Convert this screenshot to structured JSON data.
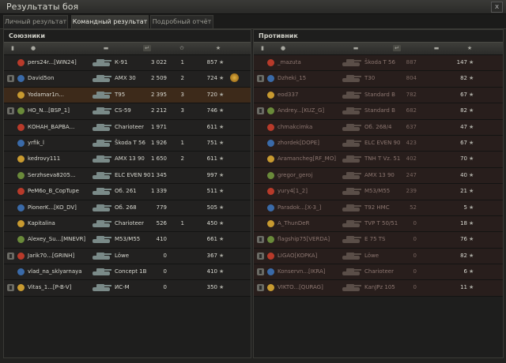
{
  "window": {
    "title": "Результаты боя",
    "close_glyph": "x"
  },
  "tabs": [
    {
      "label": "Личный результат",
      "active": false
    },
    {
      "label": "Командный результат",
      "active": true
    },
    {
      "label": "Подробный отчёт",
      "active": false
    }
  ],
  "allies": {
    "title": "Союзники",
    "rows": [
      {
        "player": "pers24r...[WIN24]",
        "tank": "KV-1",
        "tank_label": "К-91",
        "damage": "3 022",
        "frags": "1",
        "xp": "857",
        "medal": false,
        "me": false
      },
      {
        "player": "David5on",
        "tank": "AMX 30",
        "tank_label": "AMX 30",
        "damage": "2 509",
        "frags": "2",
        "xp": "724",
        "medal": true,
        "me": false
      },
      {
        "player": "Yodamar1n...",
        "tank": "T95",
        "tank_label": "T95",
        "damage": "2 395",
        "frags": "3",
        "xp": "720",
        "medal": false,
        "me": true
      },
      {
        "player": "HO_N...[BSP_1]",
        "tank": "CS-59",
        "tank_label": "CS-59",
        "damage": "2 212",
        "frags": "3",
        "xp": "746",
        "medal": false,
        "me": false
      },
      {
        "player": "КОНАН_ВАРВА...",
        "tank": "Charioteer",
        "tank_label": "Charioteer",
        "damage": "1 971",
        "frags": "",
        "xp": "611",
        "medal": false,
        "me": false
      },
      {
        "player": "yrfik_l",
        "tank": "Skoda T 56",
        "tank_label": "Škoda T 56",
        "damage": "1 926",
        "frags": "1",
        "xp": "751",
        "medal": false,
        "me": false
      },
      {
        "player": "kedrovy111",
        "tank": "AMX 13 90",
        "tank_label": "AMX 13 90",
        "damage": "1 650",
        "frags": "2",
        "xp": "611",
        "medal": false,
        "me": false
      },
      {
        "player": "Serzhseva8205...",
        "tank": "ELC EVEN 90",
        "tank_label": "ELC EVEN 90",
        "damage": "1 345",
        "frags": "",
        "xp": "997",
        "medal": false,
        "me": false
      },
      {
        "player": "PeM6o_B_CopTupe",
        "tank": "Ob. 261",
        "tank_label": "Об. 261",
        "damage": "1 339",
        "frags": "",
        "xp": "511",
        "medal": false,
        "me": false
      },
      {
        "player": "PionerK...[KO_DV]",
        "tank": "Ob. 268",
        "tank_label": "Об. 268",
        "damage": "779",
        "frags": "",
        "xp": "505",
        "medal": false,
        "me": false
      },
      {
        "player": "Kapitalina",
        "tank": "Charioteer",
        "tank_label": "Charioteer",
        "damage": "526",
        "frags": "1",
        "xp": "450",
        "medal": false,
        "me": false
      },
      {
        "player": "Alexey_Su...[MNEVR]",
        "tank": "M53/M55",
        "tank_label": "M53/M55",
        "damage": "410",
        "frags": "",
        "xp": "661",
        "medal": false,
        "me": false
      },
      {
        "player": "Jarik70...[GRINH]",
        "tank": "Lowe",
        "tank_label": "Löwe",
        "damage": "0",
        "frags": "",
        "xp": "367",
        "medal": false,
        "me": false
      },
      {
        "player": "vlad_na_sklyarnaya",
        "tank": "Concept 1B",
        "tank_label": "Concept 1B",
        "damage": "0",
        "frags": "",
        "xp": "410",
        "medal": false,
        "me": false
      },
      {
        "player": "Vitas_1...[P-B-V]",
        "tank": "VC-M",
        "tank_label": "ИС-М",
        "damage": "0",
        "frags": "",
        "xp": "350",
        "medal": false,
        "me": false
      }
    ]
  },
  "enemies": {
    "title": "Противник",
    "rows": [
      {
        "player": "_mazuta",
        "tank": "Skoda T 56",
        "tank_label": "Škoda T 56",
        "damage": "887",
        "frags": "",
        "xp": "147",
        "dead": true
      },
      {
        "player": "Dzheki_15",
        "tank": "T30",
        "tank_label": "T30",
        "damage": "804",
        "frags": "",
        "xp": "82",
        "dead": true
      },
      {
        "player": "eod337",
        "tank": "Standard B",
        "tank_label": "Standard B",
        "damage": "782",
        "frags": "",
        "xp": "67",
        "dead": true
      },
      {
        "player": "Andrey...[KUZ_G]",
        "tank": "Standard B",
        "tank_label": "Standard B",
        "damage": "682",
        "frags": "",
        "xp": "82",
        "dead": true
      },
      {
        "player": "chmakcimka",
        "tank": "Ob. 268/4",
        "tank_label": "Об. 268/4",
        "damage": "637",
        "frags": "",
        "xp": "47",
        "dead": true
      },
      {
        "player": "zhordek[DOPE]",
        "tank": "ELC EVEN 90",
        "tank_label": "ELC EVEN 90",
        "damage": "423",
        "frags": "",
        "xp": "67",
        "dead": true
      },
      {
        "player": "Aramancheg[RF_MO]",
        "tank": "TNH T Vz. 51",
        "tank_label": "TNH T Vz. 51",
        "damage": "402",
        "frags": "",
        "xp": "70",
        "dead": true
      },
      {
        "player": "gregor_geroj",
        "tank": "AMX 13 90",
        "tank_label": "AMX 13 90",
        "damage": "247",
        "frags": "",
        "xp": "40",
        "dead": true
      },
      {
        "player": "yury4[1_2]",
        "tank": "M53/M55",
        "tank_label": "M53/M55",
        "damage": "239",
        "frags": "",
        "xp": "21",
        "dead": true
      },
      {
        "player": "Paradok...[X-3_]",
        "tank": "T92 HMC",
        "tank_label": "T92 HMC",
        "damage": "52",
        "frags": "",
        "xp": "5",
        "dead": true
      },
      {
        "player": "A_ThunDeR",
        "tank": "TVP T 50/51",
        "tank_label": "TVP T 50/51",
        "damage": "0",
        "frags": "",
        "xp": "18",
        "dead": true
      },
      {
        "player": "flagship75[VERDA]",
        "tank": "E 75 TS",
        "tank_label": "E 75 TS",
        "damage": "0",
        "frags": "",
        "xp": "76",
        "dead": true
      },
      {
        "player": "LIGAO[KOPKA]",
        "tank": "Lowe",
        "tank_label": "Löwe",
        "damage": "0",
        "frags": "",
        "xp": "82",
        "dead": true
      },
      {
        "player": "Konservn...[IKRA]",
        "tank": "Charioteer",
        "tank_label": "Charioteer",
        "damage": "0",
        "frags": "",
        "xp": "6",
        "dead": true
      },
      {
        "player": "VIKTO...[QURAG]",
        "tank": "KanJPz 105",
        "tank_label": "KanJPz 105",
        "damage": "0",
        "frags": "",
        "xp": "11",
        "dead": true
      }
    ]
  },
  "columns": {
    "badge": "badge-icon",
    "player": "player-icon",
    "tank": "tank-icon",
    "damage": "damage-icon",
    "frags": "frags-icon",
    "xp": "xp-star-icon"
  },
  "colors": {
    "ally_row": "#222120",
    "me_row": "#3d2a1a",
    "enemy_row": "#2b1e1b",
    "accent_gold": "#e0b040",
    "enemy_dead_text": "#8c7670"
  }
}
